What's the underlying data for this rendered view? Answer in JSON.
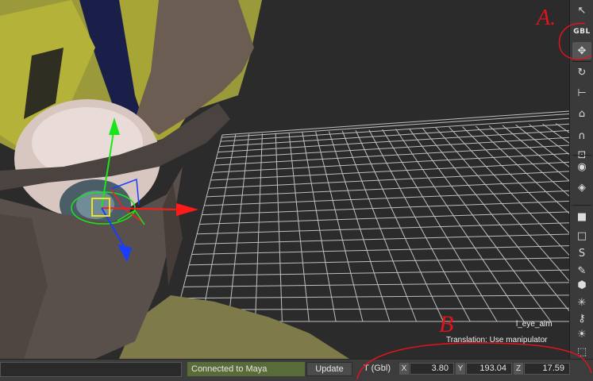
{
  "viewport": {
    "object_name": "l_eye_aim",
    "status_text": "Translation: Use manipulator"
  },
  "toolbar": {
    "tools": [
      {
        "name": "select-arrow-icon",
        "glyph": "↖"
      },
      {
        "name": "global-space-toggle",
        "glyph": "GBL"
      },
      {
        "name": "translate-icon",
        "glyph": "✥"
      },
      {
        "name": "rotate-icon",
        "glyph": "↻"
      },
      {
        "name": "scale-icon",
        "glyph": "⊢"
      },
      {
        "name": "auto-key-icon",
        "glyph": "⌂"
      },
      {
        "name": "magnet-icon",
        "glyph": "∩"
      },
      {
        "name": "pivot-icon",
        "glyph": "⊡"
      },
      {
        "name": "globe-select-icon",
        "glyph": "◉"
      },
      {
        "name": "globe-paint-icon",
        "glyph": "◈"
      },
      {
        "name": "cube-icon",
        "glyph": "■"
      },
      {
        "name": "cube-outline-icon",
        "glyph": "□"
      },
      {
        "name": "curve-icon",
        "glyph": "S"
      },
      {
        "name": "paint-brush-icon",
        "glyph": "✎"
      },
      {
        "name": "hexagon-icon",
        "glyph": "⬢"
      },
      {
        "name": "joint-icon",
        "glyph": "✳"
      },
      {
        "name": "key-icon",
        "glyph": "⚷"
      },
      {
        "name": "sun-light-icon",
        "glyph": "☀"
      },
      {
        "name": "marquee-icon",
        "glyph": "⬚"
      }
    ]
  },
  "statusbar": {
    "command_value": "",
    "connection": "Connected to Maya",
    "update_label": "Update",
    "transform_mode": "T (Gbl)",
    "x_label": "X",
    "x_value": "3.80",
    "y_label": "Y",
    "y_value": "193.04",
    "z_label": "Z",
    "z_value": "17.59"
  },
  "annotations": {
    "a": "A.",
    "b": "B"
  },
  "colors": {
    "ui_background": "#3a3a3a",
    "viewport_background": "#2b2b2b",
    "grid": "#cfcfcf",
    "connection_bg": "#5a6b3a",
    "annotation_red": "#e0141b",
    "axis_x": "#ff1a1a",
    "axis_y": "#19e619",
    "axis_z": "#1a3dff"
  }
}
